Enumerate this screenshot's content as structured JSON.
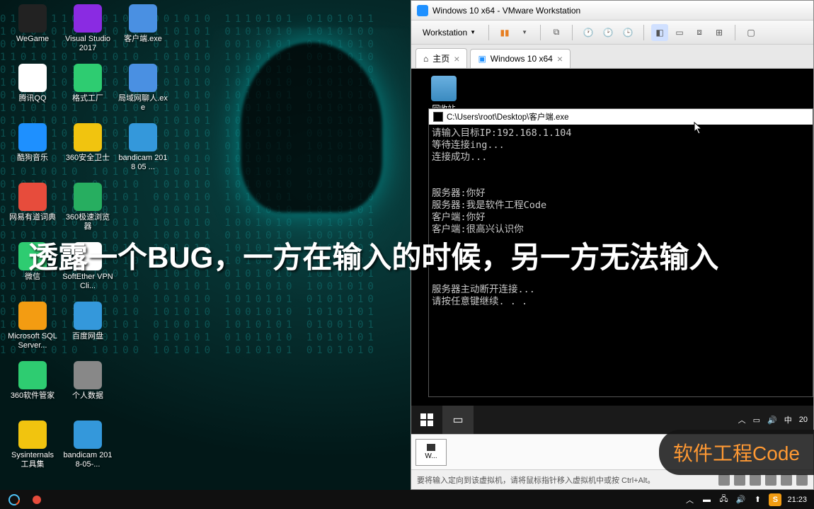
{
  "desktop": {
    "icons": [
      {
        "label": "WeGame",
        "color": "#222"
      },
      {
        "label": "Visual Studio 2017",
        "color": "#8a2be2"
      },
      {
        "label": "客户端.exe",
        "color": "#4a90e2"
      },
      {
        "label": "",
        "color": "transparent"
      },
      {
        "label": "腾讯QQ",
        "color": "#fff"
      },
      {
        "label": "格式工厂",
        "color": "#2ecc71"
      },
      {
        "label": "局域网聊人.exe",
        "color": "#4a90e2"
      },
      {
        "label": "",
        "color": "transparent"
      },
      {
        "label": "酷狗音乐",
        "color": "#1e90ff"
      },
      {
        "label": "360安全卫士",
        "color": "#f1c40f"
      },
      {
        "label": "bandicam 2018 05 ...",
        "color": "#3498db"
      },
      {
        "label": "",
        "color": "transparent"
      },
      {
        "label": "网易有道词典",
        "color": "#e74c3c"
      },
      {
        "label": "360极速浏览器",
        "color": "#27ae60"
      },
      {
        "label": "",
        "color": "transparent"
      },
      {
        "label": "",
        "color": "transparent"
      },
      {
        "label": "微信",
        "color": "#2ecc71"
      },
      {
        "label": "SoftEther VPN Cli...",
        "color": "#fff"
      },
      {
        "label": "",
        "color": "transparent"
      },
      {
        "label": "",
        "color": "transparent"
      },
      {
        "label": "Microsoft SQL Server...",
        "color": "#f39c12"
      },
      {
        "label": "百度网盘",
        "color": "#3498db"
      },
      {
        "label": "",
        "color": "transparent"
      },
      {
        "label": "",
        "color": "transparent"
      },
      {
        "label": "360软件管家",
        "color": "#2ecc71"
      },
      {
        "label": "个人数据",
        "color": "#888"
      },
      {
        "label": "",
        "color": "transparent"
      },
      {
        "label": "",
        "color": "transparent"
      },
      {
        "label": "Sysinternals 工具集",
        "color": "#f1c40f"
      },
      {
        "label": "bandicam 2018-05-...",
        "color": "#3498db"
      }
    ]
  },
  "vmware": {
    "title": "Windows 10 x64 - VMware Workstation",
    "menu_label": "Workstation",
    "tabs": {
      "home": "主页",
      "vm": "Windows 10 x64"
    },
    "statusbar_text": "要将输入定向到该虚拟机，请将鼠标指针移入虚拟机中或按 Ctrl+Alt。",
    "host_tab": "W..."
  },
  "guest": {
    "recycle_bin": "回收站",
    "tray_lang": "中",
    "tray_time": "20"
  },
  "console": {
    "title": "C:\\Users\\root\\Desktop\\客户端.exe",
    "lines": [
      "请输入目标IP:192.168.1.104",
      "等待连接ing...",
      "连接成功...",
      "",
      "",
      "服务器:你好",
      "服务器:我是软件工程Code",
      "客户端:你好",
      "客户端:很高兴认识你",
      "",
      "",
      "",
      "",
      "服务器主动断开连接...",
      "请按任意键继续. . ."
    ]
  },
  "overlay": {
    "caption": "透露一个BUG，一方在输入的时候，另一方无法输入",
    "watermark": "软件工程Code"
  },
  "host_taskbar": {
    "ime": "S",
    "time": "21:23"
  }
}
